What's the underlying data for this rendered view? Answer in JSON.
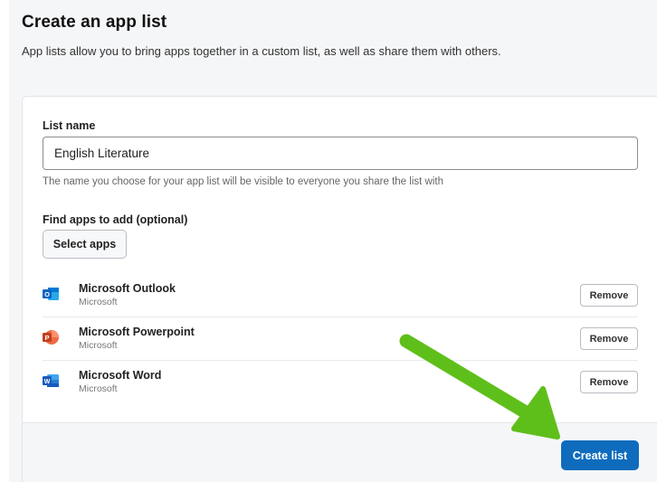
{
  "header": {
    "title": "Create an app list",
    "subtitle": "App lists allow you to bring apps together in a custom list, as well as share them with others."
  },
  "form": {
    "list_name_label": "List name",
    "list_name_value": "English Literature",
    "list_name_helper": "The name you choose for your app list will be visible to everyone you share the list with",
    "find_apps_label": "Find apps to add (optional)",
    "select_apps_label": "Select apps"
  },
  "apps": [
    {
      "name": "Microsoft Outlook",
      "publisher": "Microsoft",
      "icon": "outlook-icon",
      "letter": "O",
      "remove_label": "Remove"
    },
    {
      "name": "Microsoft Powerpoint",
      "publisher": "Microsoft",
      "icon": "powerpoint-icon",
      "letter": "P",
      "remove_label": "Remove"
    },
    {
      "name": "Microsoft Word",
      "publisher": "Microsoft",
      "icon": "word-icon",
      "letter": "W",
      "remove_label": "Remove"
    }
  ],
  "footer": {
    "create_label": "Create list"
  },
  "colors": {
    "primary": "#0f6cbd",
    "annotation_arrow": "#5fbf1a",
    "outlook": "#0a64c4",
    "powerpoint": "#c43e1c",
    "word": "#185abd"
  }
}
